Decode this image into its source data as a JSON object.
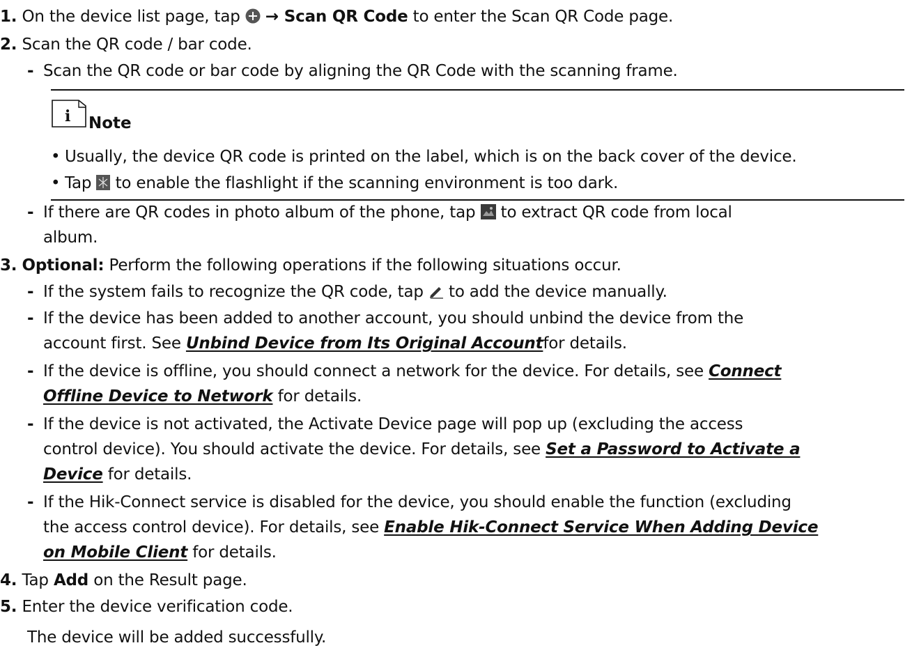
{
  "steps": [
    {
      "num": "1.",
      "pre": "On the device list page, tap",
      "bold": "→ Scan QR Code",
      "post": "to enter the Scan QR Code page."
    },
    {
      "num": "2.",
      "text": "Scan the QR code / bar code."
    },
    {
      "num": "3.",
      "bold": "Optional:",
      "text": "Perform the following operations if the following situations occur."
    },
    {
      "num": "4.",
      "pre": "Tap",
      "bold": "Add",
      "post": "on the Result page."
    },
    {
      "num": "5.",
      "text": "Enter the device verification code."
    }
  ],
  "step2": {
    "sub1": "Scan the QR code or bar code by aligning the QR Code with the scanning frame.",
    "note": {
      "label": "Note",
      "items": [
        "Usually, the device QR code is printed on the label, which is on the back cover of the device.",
        {
          "pre": "Tap",
          "post": "to enable the flashlight if the scanning environment is too dark."
        }
      ]
    },
    "sub2": {
      "pre": "If there are QR codes in photo album of the phone, tap",
      "post": "to extract QR code from local",
      "cont": "album."
    }
  },
  "step3": {
    "items": [
      {
        "pre": "If the system fails to recognize the QR code, tap",
        "post": "to add the device manually."
      },
      {
        "line1": "If the device has been added to another account, you should unbind the device from the",
        "line2_pre": "account first. See",
        "link": "Unbind Device from Its Original Account",
        "line2_post": "for details."
      },
      {
        "line1_pre": "If the device is offline, you should connect a network for the device. For details, see",
        "link_a": "Connect",
        "link_b": "Offline Device to Network",
        "line2_post": "for details."
      },
      {
        "line1": "If the device is not activated, the Activate Device page will pop up (excluding the access",
        "line2_pre": "control device). You should activate the device. For details, see",
        "link_a": "Set a Password to Activate a",
        "link_b": "Device",
        "line3_post": "for details."
      },
      {
        "line1": "If the Hik-Connect service is disabled for the device, you should enable the function (excluding",
        "line2_pre": "the access control device). For details, see",
        "link_a": "Enable Hik-Connect Service When Adding Device",
        "link_b": "on Mobile Client",
        "line3_post": "for details."
      }
    ]
  },
  "step5_result": "The device will be added successfully.",
  "colors": {
    "text": "#111111",
    "icon_dark": "#333333",
    "album_icon": "#3a3a3a"
  },
  "icons": [
    "add-circle-icon",
    "note-info-icon",
    "flashlight-icon",
    "album-icon",
    "pencil-icon"
  ]
}
